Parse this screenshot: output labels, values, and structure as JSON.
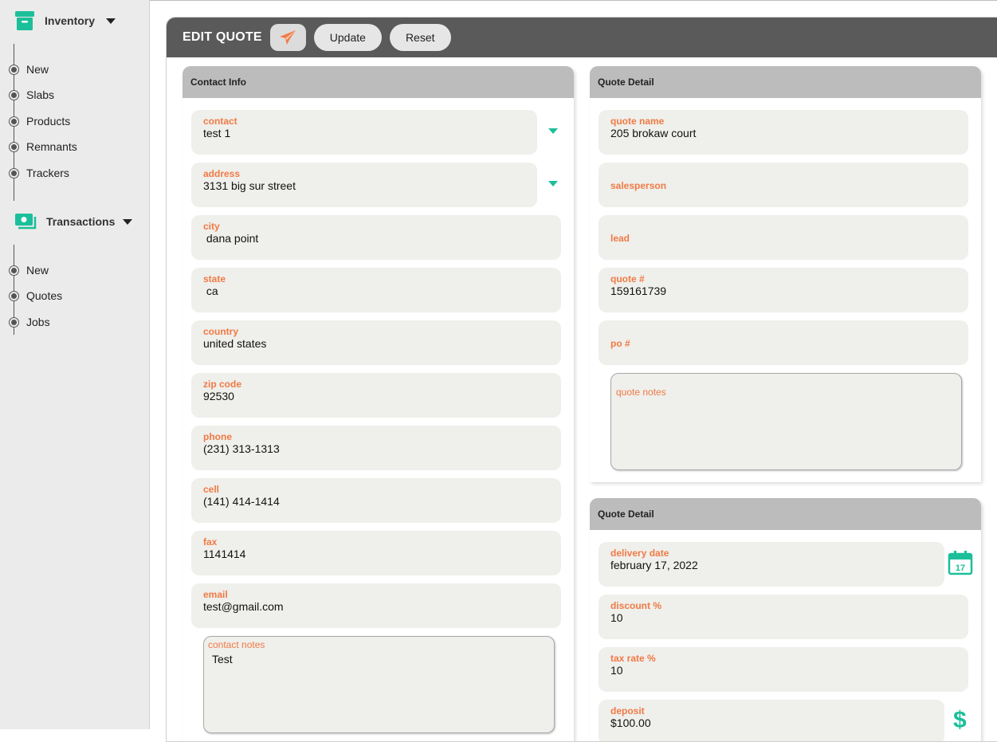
{
  "sidebar": {
    "groups": [
      {
        "label": "Inventory",
        "icon": "archive-box-icon",
        "items": [
          "New",
          "Slabs",
          "Products",
          "Remnants",
          "Trackers"
        ]
      },
      {
        "label": "Transactions",
        "icon": "money-icon",
        "items": [
          "New",
          "Quotes",
          "Jobs"
        ]
      }
    ]
  },
  "header": {
    "title": "EDIT QUOTE",
    "send_icon": "paper-plane-icon",
    "update_label": "Update",
    "reset_label": "Reset"
  },
  "contact_info": {
    "title": "Contact Info",
    "fields": [
      {
        "label": "contact",
        "value": "test 1"
      },
      {
        "label": "address",
        "value": "3131 big sur street"
      },
      {
        "label": "city",
        "value": " dana point"
      },
      {
        "label": "state",
        "value": " ca"
      },
      {
        "label": "country",
        "value": "united states"
      },
      {
        "label": "zip code",
        "value": "92530"
      },
      {
        "label": "phone",
        "value": "(231) 313-1313"
      },
      {
        "label": "cell",
        "value": "(141) 414-1414"
      },
      {
        "label": "fax",
        "value": "1141414"
      },
      {
        "label": "email",
        "value": "test@gmail.com"
      }
    ],
    "notes_label": "contact notes",
    "notes_value": "Test"
  },
  "quote_detail": {
    "title": "Quote Detail",
    "fields": [
      {
        "label": "quote name",
        "value": "205 brokaw court"
      },
      {
        "label": "salesperson",
        "value": ""
      },
      {
        "label": "lead",
        "value": ""
      },
      {
        "label": "quote #",
        "value": "159161739"
      },
      {
        "label": "po #",
        "value": ""
      }
    ],
    "notes_label": "quote notes"
  },
  "quote_detail_2": {
    "title": "Quote Detail",
    "fields": [
      {
        "label": "delivery date",
        "value": "february 17, 2022"
      },
      {
        "label": "discount %",
        "value": "10"
      },
      {
        "label": "tax rate %",
        "value": "10"
      },
      {
        "label": "deposit",
        "value": "$100.00"
      }
    ],
    "calendar_day": "17"
  },
  "colors": {
    "accent": "#1bbf9a",
    "label": "#f07a45",
    "header": "#5a5a5a"
  }
}
